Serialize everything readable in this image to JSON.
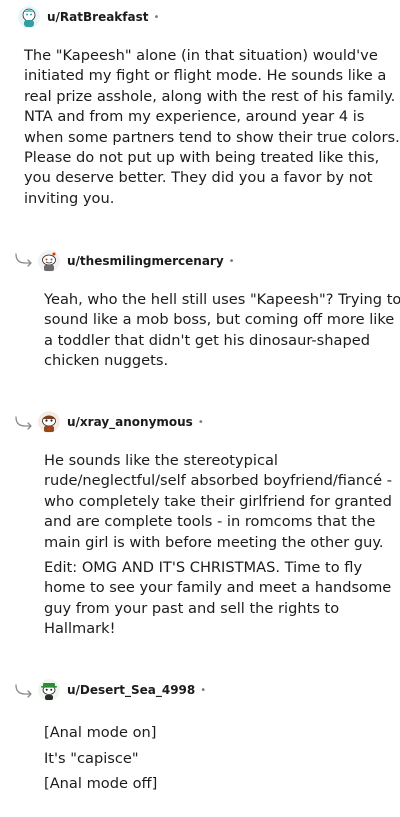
{
  "comments": [
    {
      "username": "u/RatBreakfast",
      "meta_dot": "•",
      "avatar_icon": "snoo-avatar-teal",
      "lines": [
        "The \"Kapeesh\" alone (in that situation) would've",
        "initiated my fight or flight mode. He sounds like a",
        "real prize asshole, along with the rest of his family.",
        "NTA and from my experience, around year 4 is",
        "when some partners tend to show their true colors.",
        "Please do not put up with being treated like this,",
        "you deserve better. They did you a favor by not",
        "inviting you."
      ]
    },
    {
      "username": "u/thesmilingmercenary",
      "meta_dot": "•",
      "avatar_icon": "snoo-avatar-white",
      "reply_icon": "reply-arrow-icon",
      "lines": [
        "Yeah, who the hell still uses \"Kapeesh\"? Trying to",
        "sound like a mob boss, but coming off more like",
        "a toddler that didn't get his dinosaur-shaped",
        "chicken nuggets."
      ]
    },
    {
      "username": "u/xray_anonymous",
      "meta_dot": "•",
      "avatar_icon": "snoo-avatar-brown",
      "reply_icon": "reply-arrow-icon",
      "paragraph1": [
        "He sounds like the stereotypical",
        "rude/neglectful/self absorbed boyfriend/fiancé -",
        "who completely take their girlfriend for granted",
        "and are complete tools - in romcoms that the",
        "main girl is with before meeting the other guy."
      ],
      "paragraph2": [
        "Edit: OMG AND IT'S CHRISTMAS. Time to fly",
        "home to see your family and meet a handsome",
        "guy from your past and sell the rights to",
        "Hallmark!"
      ]
    },
    {
      "username": "u/Desert_Sea_4998",
      "meta_dot": "•",
      "avatar_icon": "snoo-avatar-green-hat",
      "reply_icon": "reply-arrow-icon",
      "lines": [
        "[Anal mode on]",
        "It's \"capisce\"",
        "[Anal mode off]"
      ]
    }
  ]
}
